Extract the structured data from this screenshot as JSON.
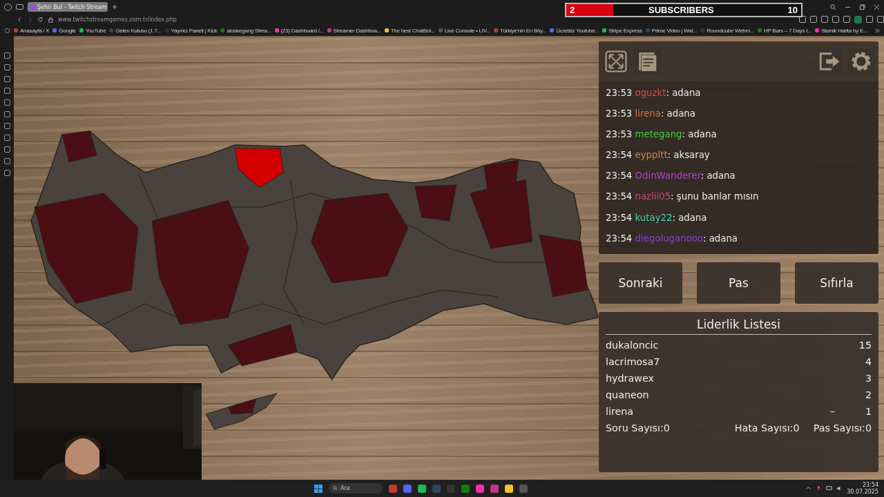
{
  "browser": {
    "tab": {
      "title": "Şehir Bul - Twitch Stream",
      "selected": true
    },
    "url": "www.twitchstreamgames.com.tr/index.php",
    "bookmarks": [
      "Anasayfa / X",
      "Google",
      "YouTube",
      "Gelen Kutusu (1.7...",
      "Yayıncı Paneli | Kick",
      "aloskegang Strea...",
      "(23) Dashboard /...",
      "Streamer Dashboa...",
      "The best ChatBot...",
      "Live Console • LIV...",
      "Türkiye'nin En Büy...",
      "Ücretsiz Youtube...",
      "Stripe Express",
      "Prime Video | Wat...",
      "Roundcube Webm...",
      "HP Bars – 7 Days t...",
      "Sismik Harita by E..."
    ]
  },
  "subscriber_goal": {
    "current": "2",
    "label": "SUBSCRIBERS",
    "target": "10",
    "level": 0.2
  },
  "chat": [
    {
      "time": "23:53",
      "user": "oguzkt",
      "color": "#e0483c",
      "message": ": adana"
    },
    {
      "time": "23:53",
      "user": "lirena",
      "color": "#d2773a",
      "message": ": adana"
    },
    {
      "time": "23:53",
      "user": "metegang",
      "color": "#3ecf3e",
      "message": ": adana"
    },
    {
      "time": "23:54",
      "user": "eyppltt",
      "color": "#d0844a",
      "message": ": aksaray"
    },
    {
      "time": "23:54",
      "user": "OdinWanderer",
      "color": "#b43cd2",
      "message": ": adana"
    },
    {
      "time": "23:54",
      "user": "nazlii05",
      "color": "#c8467a",
      "message": ": şunu banlar mısın"
    },
    {
      "time": "23:54",
      "user": "kutay22",
      "color": "#45d2b4",
      "message": ": adana"
    },
    {
      "time": "23:54",
      "user": "diegoluganooo",
      "color": "#8a3cd2",
      "message": ": adana"
    }
  ],
  "buttons": [
    "Sonraki",
    "Pas",
    "Sıfırla"
  ],
  "leaderboard": {
    "title": "Liderlik Listesi",
    "rows": [
      {
        "name": "dukaloncic",
        "score": "15"
      },
      {
        "name": "lacrimosa7",
        "score": "4"
      },
      {
        "name": "hydrawex",
        "score": "3"
      },
      {
        "name": "quaneon",
        "score": "2"
      },
      {
        "name": "lirena",
        "mark": "–",
        "score": "1"
      }
    ],
    "stats": [
      {
        "label": "Soru Sayısı:",
        "value": "0"
      },
      {
        "label": "Hata Sayısı:",
        "value": "0"
      },
      {
        "label": "Pas Sayısı:",
        "value": "0"
      }
    ]
  },
  "taskbar": {
    "search": "Ara",
    "time": "23:54",
    "date": "30.07.2025"
  }
}
